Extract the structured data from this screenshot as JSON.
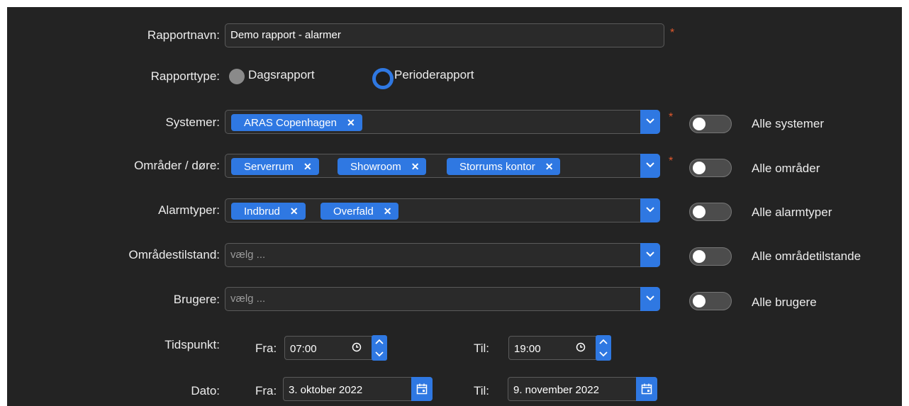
{
  "form": {
    "report_name": {
      "label": "Rapportnavn:",
      "value": "Demo rapport - alarmer",
      "required": "*"
    },
    "report_type": {
      "label": "Rapporttype:",
      "option_daily": "Dagsrapport",
      "option_period": "Perioderapport",
      "selected": "Perioderapport"
    },
    "systems": {
      "label": "Systemer:",
      "chips": [
        "ARAS Copenhagen"
      ],
      "required": "*",
      "toggle_label": "Alle systemer"
    },
    "areas": {
      "label": "Områder / døre:",
      "chips": [
        "Serverrum",
        "Showroom",
        "Storrums kontor"
      ],
      "required": "*",
      "toggle_label": "Alle områder"
    },
    "alarm_types": {
      "label": "Alarmtyper:",
      "chips": [
        "Indbrud",
        "Overfald"
      ],
      "toggle_label": "Alle alarmtyper"
    },
    "area_state": {
      "label": "Områdestilstand:",
      "placeholder": "vælg ...",
      "toggle_label": "Alle områdetilstande"
    },
    "users": {
      "label": "Brugere:",
      "placeholder": "vælg ...",
      "toggle_label": "Alle brugere"
    },
    "time": {
      "label": "Tidspunkt:",
      "from_label": "Fra:",
      "from_value": "07:00",
      "to_label": "Til:",
      "to_value": "19:00"
    },
    "date": {
      "label": "Dato:",
      "from_label": "Fra:",
      "from_value": "3. oktober 2022",
      "to_label": "Til:",
      "to_value": "9. november 2022"
    }
  },
  "colors": {
    "accent": "#2f78e2",
    "background": "#232323",
    "required": "#e0582c"
  }
}
